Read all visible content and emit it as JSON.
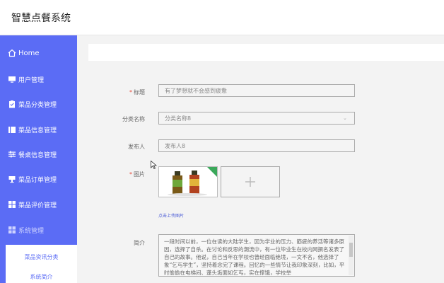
{
  "app": {
    "title": "智慧点餐系统"
  },
  "sidebar": {
    "items": [
      {
        "label": "Home",
        "icon": "home-icon"
      },
      {
        "label": "用户管理",
        "icon": "monitor-icon"
      },
      {
        "label": "菜品分类管理",
        "icon": "clipboard-icon"
      },
      {
        "label": "菜品信息管理",
        "icon": "book-icon"
      },
      {
        "label": "餐桌信息管理",
        "icon": "sliders-icon"
      },
      {
        "label": "菜品订单管理",
        "icon": "cup-icon"
      },
      {
        "label": "菜品评价管理",
        "icon": "grid-icon"
      },
      {
        "label": "系统管理",
        "icon": "grid-icon"
      }
    ],
    "submenu": [
      {
        "label": "菜品资讯分类"
      },
      {
        "label": "系统简介"
      }
    ]
  },
  "form": {
    "title": {
      "label": "标题",
      "required": "*",
      "value": "有了梦想就不会感到疲惫"
    },
    "category": {
      "label": "分类名称",
      "value": "分类名称8"
    },
    "publisher": {
      "label": "发布人",
      "value": "发布人8"
    },
    "image": {
      "label": "图片",
      "required": "*",
      "upload_hint": "点击上传图片"
    },
    "intro": {
      "label": "简介",
      "value": "一段时间以前，一位在读的大陆学生，因为学业的压力、筋疲的养活等诸多原因，选择了自杀。在讨论和反思的潮流中，有一位毕业生在校内网撰名发表了自己的故事。他说，自己当年在学校也曾经面临绝境，一文不名，他选择了象“乞丐学生”，坚持着念完了课程。回忆的一些情节让我印象深刻，比如，平时偷偷在电梯间、蓬头垢面如乞丐，实在撑饿，学校举"
    }
  },
  "colors": {
    "sidebar_bg": "#5b6cf5",
    "accent": "#5b6cf5",
    "required": "#e74c3c"
  }
}
